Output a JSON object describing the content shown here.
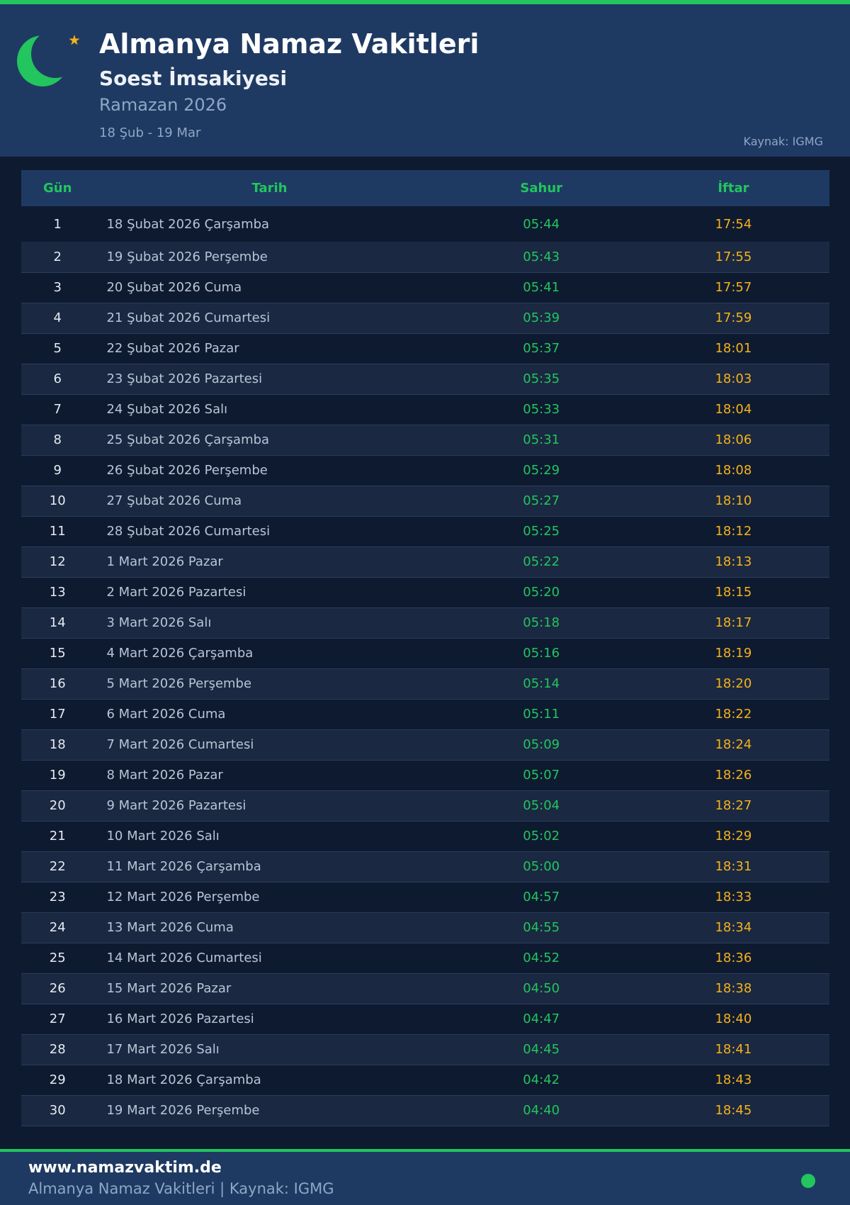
{
  "header": {
    "title": "Almanya Namaz Vakitleri",
    "subtitle": "Soest İmsakiyesi",
    "season": "Ramazan 2026",
    "range": "18 Şub - 19 Mar",
    "source": "Kaynak: IGMG"
  },
  "colors": {
    "accent_green": "#22c55e",
    "iftar_gold": "#f5b21a",
    "header_bg": "#1f3a62",
    "page_bg": "#0e1a30"
  },
  "icons": {
    "logo": "crescent-moon-star-icon",
    "status": "status-dot"
  },
  "table": {
    "columns": {
      "day": "Gün",
      "date": "Tarih",
      "sahur": "Sahur",
      "iftar": "İftar"
    },
    "rows": [
      {
        "day": "1",
        "date": "18 Şubat 2026 Çarşamba",
        "sahur": "05:44",
        "iftar": "17:54"
      },
      {
        "day": "2",
        "date": "19 Şubat 2026 Perşembe",
        "sahur": "05:43",
        "iftar": "17:55"
      },
      {
        "day": "3",
        "date": "20 Şubat 2026 Cuma",
        "sahur": "05:41",
        "iftar": "17:57"
      },
      {
        "day": "4",
        "date": "21 Şubat 2026 Cumartesi",
        "sahur": "05:39",
        "iftar": "17:59"
      },
      {
        "day": "5",
        "date": "22 Şubat 2026 Pazar",
        "sahur": "05:37",
        "iftar": "18:01"
      },
      {
        "day": "6",
        "date": "23 Şubat 2026 Pazartesi",
        "sahur": "05:35",
        "iftar": "18:03"
      },
      {
        "day": "7",
        "date": "24 Şubat 2026 Salı",
        "sahur": "05:33",
        "iftar": "18:04"
      },
      {
        "day": "8",
        "date": "25 Şubat 2026 Çarşamba",
        "sahur": "05:31",
        "iftar": "18:06"
      },
      {
        "day": "9",
        "date": "26 Şubat 2026 Perşembe",
        "sahur": "05:29",
        "iftar": "18:08"
      },
      {
        "day": "10",
        "date": "27 Şubat 2026 Cuma",
        "sahur": "05:27",
        "iftar": "18:10"
      },
      {
        "day": "11",
        "date": "28 Şubat 2026 Cumartesi",
        "sahur": "05:25",
        "iftar": "18:12"
      },
      {
        "day": "12",
        "date": "1 Mart 2026 Pazar",
        "sahur": "05:22",
        "iftar": "18:13"
      },
      {
        "day": "13",
        "date": "2 Mart 2026 Pazartesi",
        "sahur": "05:20",
        "iftar": "18:15"
      },
      {
        "day": "14",
        "date": "3 Mart 2026 Salı",
        "sahur": "05:18",
        "iftar": "18:17"
      },
      {
        "day": "15",
        "date": "4 Mart 2026 Çarşamba",
        "sahur": "05:16",
        "iftar": "18:19"
      },
      {
        "day": "16",
        "date": "5 Mart 2026 Perşembe",
        "sahur": "05:14",
        "iftar": "18:20"
      },
      {
        "day": "17",
        "date": "6 Mart 2026 Cuma",
        "sahur": "05:11",
        "iftar": "18:22"
      },
      {
        "day": "18",
        "date": "7 Mart 2026 Cumartesi",
        "sahur": "05:09",
        "iftar": "18:24"
      },
      {
        "day": "19",
        "date": "8 Mart 2026 Pazar",
        "sahur": "05:07",
        "iftar": "18:26"
      },
      {
        "day": "20",
        "date": "9 Mart 2026 Pazartesi",
        "sahur": "05:04",
        "iftar": "18:27"
      },
      {
        "day": "21",
        "date": "10 Mart 2026 Salı",
        "sahur": "05:02",
        "iftar": "18:29"
      },
      {
        "day": "22",
        "date": "11 Mart 2026 Çarşamba",
        "sahur": "05:00",
        "iftar": "18:31"
      },
      {
        "day": "23",
        "date": "12 Mart 2026 Perşembe",
        "sahur": "04:57",
        "iftar": "18:33"
      },
      {
        "day": "24",
        "date": "13 Mart 2026 Cuma",
        "sahur": "04:55",
        "iftar": "18:34"
      },
      {
        "day": "25",
        "date": "14 Mart 2026 Cumartesi",
        "sahur": "04:52",
        "iftar": "18:36"
      },
      {
        "day": "26",
        "date": "15 Mart 2026 Pazar",
        "sahur": "04:50",
        "iftar": "18:38"
      },
      {
        "day": "27",
        "date": "16 Mart 2026 Pazartesi",
        "sahur": "04:47",
        "iftar": "18:40"
      },
      {
        "day": "28",
        "date": "17 Mart 2026 Salı",
        "sahur": "04:45",
        "iftar": "18:41"
      },
      {
        "day": "29",
        "date": "18 Mart 2026 Çarşamba",
        "sahur": "04:42",
        "iftar": "18:43"
      },
      {
        "day": "30",
        "date": "19 Mart 2026 Perşembe",
        "sahur": "04:40",
        "iftar": "18:45"
      }
    ]
  },
  "footer": {
    "site": "www.namazvaktim.de",
    "note": "Almanya Namaz Vakitleri | Kaynak: IGMG"
  }
}
